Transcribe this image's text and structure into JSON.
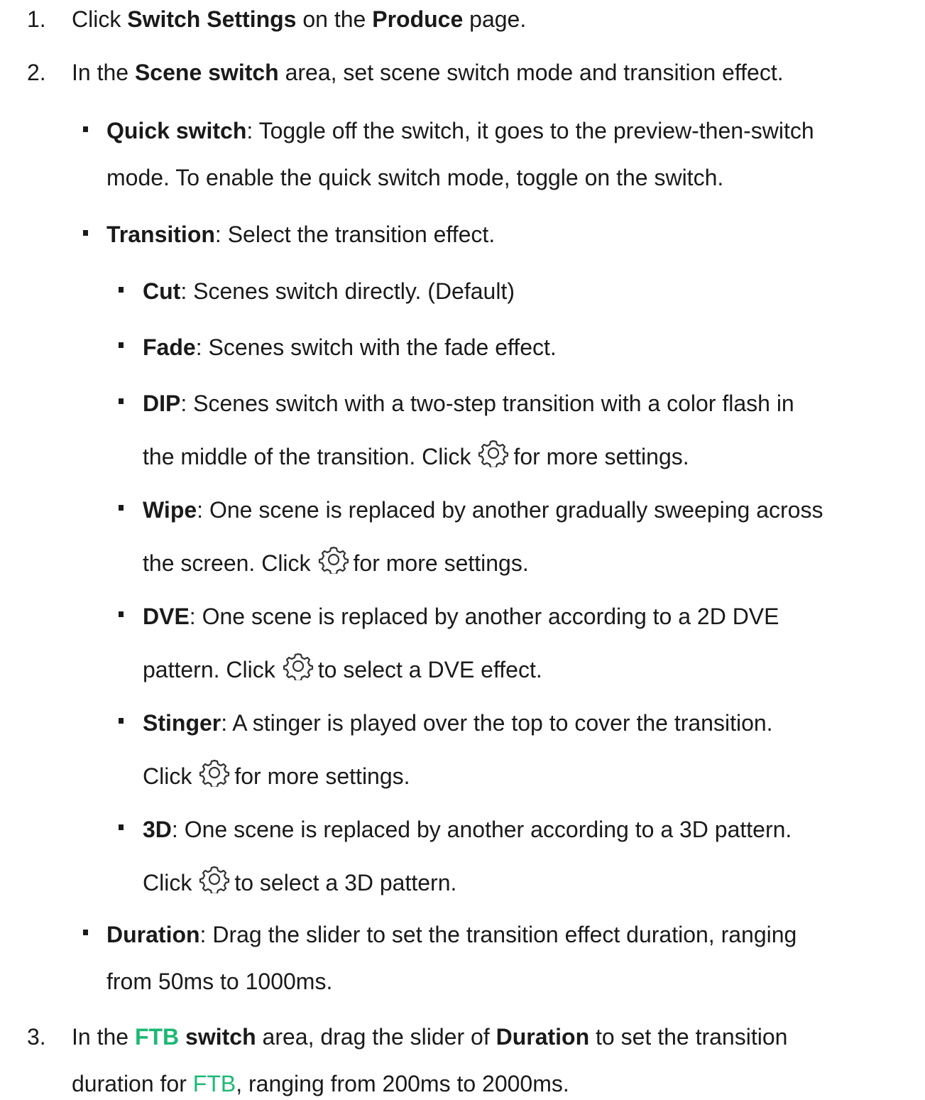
{
  "steps": [
    {
      "number": "1.",
      "parts": [
        "Click ",
        "Switch Settings",
        " on the ",
        "Produce",
        " page."
      ]
    },
    {
      "number": "2.",
      "parts": [
        "In the ",
        "Scene switch",
        " area, set scene switch mode and transition effect."
      ],
      "items": {
        "quick": {
          "term": "Quick switch",
          "line1": ": Toggle off the switch, it goes to the preview-then-switch",
          "line2": "mode. To enable the quick switch mode, toggle on the switch."
        },
        "transition": {
          "term": "Transition",
          "text": ": Select the transition effect."
        },
        "cut": {
          "term": "Cut",
          "text": ": Scenes switch directly. (Default)"
        },
        "fade": {
          "term": "Fade",
          "text": ": Scenes switch with the fade effect."
        },
        "dip": {
          "term": "DIP",
          "line1": ": Scenes switch with a two-step transition with a color flash in",
          "line2a": "the middle of the transition. Click",
          "line2b": "for more settings."
        },
        "wipe": {
          "term": "Wipe",
          "line1": ": One scene is replaced by another gradually sweeping across",
          "line2a": "the screen. Click",
          "line2b": "for more settings."
        },
        "dve": {
          "term": "DVE",
          "line1": ": One scene is replaced by another according to a 2D DVE",
          "line2a": "pattern. Click",
          "line2b": "to select a DVE effect."
        },
        "stinger": {
          "term": "Stinger",
          "line1": ": A stinger is played over the top to cover the transition.",
          "line2a": "Click",
          "line2b": "for more settings."
        },
        "threed": {
          "term": "3D",
          "line1": ": One scene is replaced by another according to a 3D pattern.",
          "line2a": "Click",
          "line2b": "to select a 3D pattern."
        },
        "duration": {
          "term": "Duration",
          "line1": ": Drag the slider to set the transition effect duration, ranging",
          "line2": "from 50ms to 1000ms."
        }
      }
    },
    {
      "number": "3.",
      "parts": [
        "In the ",
        "FTB",
        " switch",
        " area, drag the slider of ",
        "Duration",
        " to set the transition"
      ],
      "line2": [
        "duration for ",
        "FTB",
        ", ranging from 200ms to 2000ms."
      ]
    }
  ],
  "icons": {
    "settings": "gear-icon"
  },
  "colors": {
    "text": "#1a1a1a",
    "accent": "#1db876"
  }
}
